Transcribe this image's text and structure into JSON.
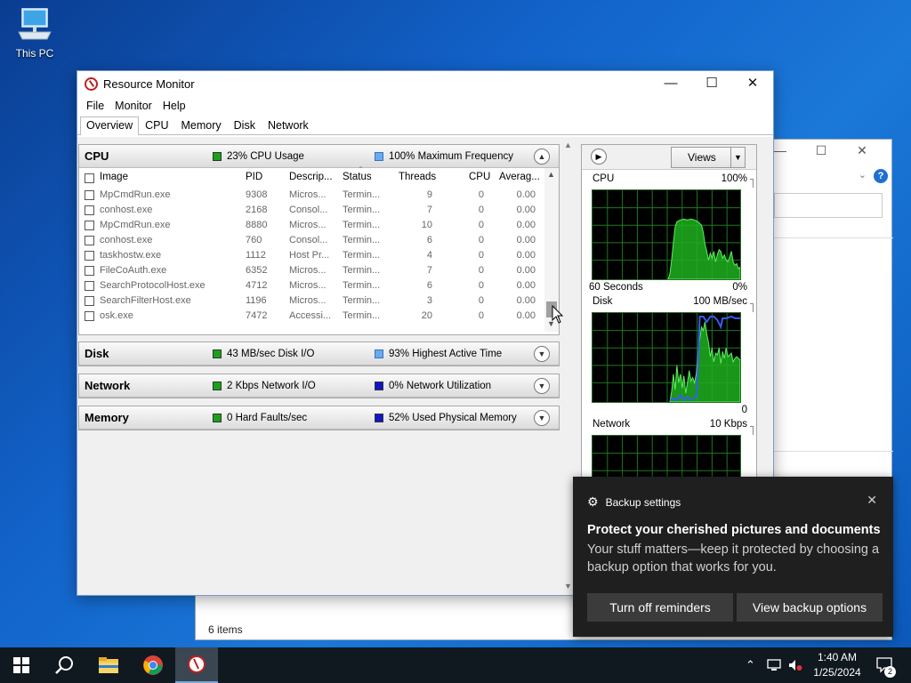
{
  "desktop": {
    "icon_label": "This PC"
  },
  "bg_window": {
    "status": "6 items",
    "help": "?"
  },
  "window": {
    "title": "Resource Monitor",
    "menu": [
      "File",
      "Monitor",
      "Help"
    ],
    "tabs": [
      "Overview",
      "CPU",
      "Memory",
      "Disk",
      "Network"
    ],
    "active_tab": "Overview"
  },
  "cpu": {
    "name": "CPU",
    "ind1": "23% CPU Usage",
    "ind2": "100% Maximum Frequency",
    "columns": [
      "Image",
      "PID",
      "Descrip...",
      "Status",
      "Threads",
      "CPU",
      "Averag..."
    ],
    "rows": [
      {
        "image": "MpCmdRun.exe",
        "pid": "9308",
        "desc": "Micros...",
        "status": "Termin...",
        "threads": "9",
        "cpu": "0",
        "avg": "0.00"
      },
      {
        "image": "conhost.exe",
        "pid": "2168",
        "desc": "Consol...",
        "status": "Termin...",
        "threads": "7",
        "cpu": "0",
        "avg": "0.00"
      },
      {
        "image": "MpCmdRun.exe",
        "pid": "8880",
        "desc": "Micros...",
        "status": "Termin...",
        "threads": "10",
        "cpu": "0",
        "avg": "0.00"
      },
      {
        "image": "conhost.exe",
        "pid": "760",
        "desc": "Consol...",
        "status": "Termin...",
        "threads": "6",
        "cpu": "0",
        "avg": "0.00"
      },
      {
        "image": "taskhostw.exe",
        "pid": "1112",
        "desc": "Host Pr...",
        "status": "Termin...",
        "threads": "4",
        "cpu": "0",
        "avg": "0.00"
      },
      {
        "image": "FileCoAuth.exe",
        "pid": "6352",
        "desc": "Micros...",
        "status": "Termin...",
        "threads": "7",
        "cpu": "0",
        "avg": "0.00"
      },
      {
        "image": "SearchProtocolHost.exe",
        "pid": "4712",
        "desc": "Micros...",
        "status": "Termin...",
        "threads": "6",
        "cpu": "0",
        "avg": "0.00"
      },
      {
        "image": "SearchFilterHost.exe",
        "pid": "1196",
        "desc": "Micros...",
        "status": "Termin...",
        "threads": "3",
        "cpu": "0",
        "avg": "0.00"
      },
      {
        "image": "osk.exe",
        "pid": "7472",
        "desc": "Accessi...",
        "status": "Termin...",
        "threads": "20",
        "cpu": "0",
        "avg": "0.00"
      }
    ]
  },
  "disk": {
    "name": "Disk",
    "ind1": "43 MB/sec Disk I/O",
    "ind2": "93% Highest Active Time"
  },
  "network": {
    "name": "Network",
    "ind1": "2 Kbps Network I/O",
    "ind2": "0% Network Utilization"
  },
  "memory": {
    "name": "Memory",
    "ind1": "0 Hard Faults/sec",
    "ind2": "52% Used Physical Memory"
  },
  "right_pane": {
    "views_label": "Views",
    "cpu_graph": {
      "label": "CPU",
      "max": "100%",
      "time": "60 Seconds",
      "min": "0%"
    },
    "disk_graph": {
      "label": "Disk",
      "max": "100 MB/sec",
      "min": "0"
    },
    "net_graph": {
      "label": "Network",
      "max": "10 Kbps"
    }
  },
  "toast": {
    "app": "Backup settings",
    "heading": "Protect your cherished pictures and documents",
    "body": "Your stuff matters—keep it protected by choosing a backup option that works for you.",
    "btn1": "Turn off reminders",
    "btn2": "View backup options"
  },
  "taskbar": {
    "time": "1:40 AM",
    "date": "1/25/2024",
    "notif_count": "2"
  },
  "colors": {
    "graph_green": "#2ecc2e",
    "graph_blue": "#3a5cf0",
    "accent_blue": "#1f6fd1"
  }
}
